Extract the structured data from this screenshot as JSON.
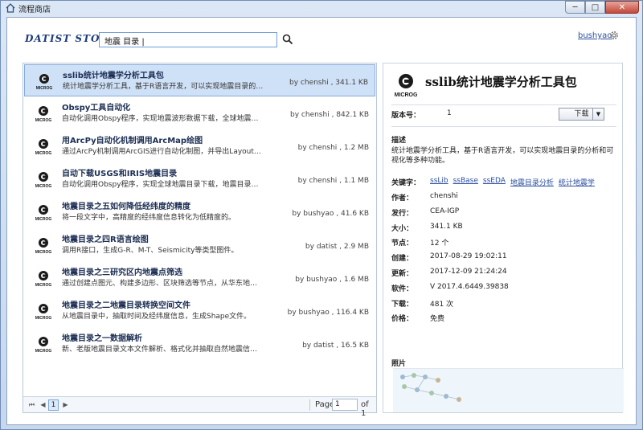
{
  "window": {
    "title": "流程商店",
    "min_label": "─",
    "max_label": "□",
    "close_label": "✕"
  },
  "header": {
    "logo_text": "DATIST STORE",
    "search_value": "地震 目录 |",
    "user": "bushyao"
  },
  "list": [
    {
      "title": "sslib统计地震学分析工具包",
      "desc": "统计地震学分析工具，基于R语言开发，可以实现地震目录的分析和可视化等多…",
      "meta": "by chenshi , 341.1 KB",
      "logo": "MICROG"
    },
    {
      "title": "Obspy工具自动化",
      "desc": "自动化调用Obspy程序，实现地震波形数据下载，全球地震目录下载等功能",
      "meta": "by chenshi , 842.1 KB",
      "logo": "MICROG"
    },
    {
      "title": "用ArcPy自动化机制调用ArcMap绘图",
      "desc": "通过ArcPy机制调用ArcGIS进行自动化制图，并导出Layout或Frame图形到本地…",
      "meta": "by chenshi , 1.2 MB",
      "logo": "MICROG"
    },
    {
      "title": "自动下载USGS和IRIS地震目录",
      "desc": "自动化调用Obspy程序，实现全球地震目录下载，地震目录格式转换（支持…",
      "meta": "by chenshi , 1.1 MB",
      "logo": "MICROG"
    },
    {
      "title": "地震目录之五如何降低经纬度的精度",
      "desc": "将一段文字中，高精度的经纬度信息转化为低精度的。",
      "meta": "by bushyao , 41.6 KB",
      "logo": "MICROG"
    },
    {
      "title": "地震目录之四R语言绘图",
      "desc": "调用R接口，生成G-R、M-T、Seismicity等类型图件。",
      "meta": "by datist , 2.9 MB",
      "logo": "MICROG"
    },
    {
      "title": "地震目录之三研究区内地震点筛选",
      "desc": "通过创建点图元、构建多边形、区块筛选等节点，从华东地震目录中抽取研究…",
      "meta": "by bushyao , 1.6 MB",
      "logo": "MICROG"
    },
    {
      "title": "地震目录之二地震目录转换空间文件",
      "desc": "从地震目录中，抽取时间及经纬度信息，生成Shape文件。",
      "meta": "by bushyao , 116.4 KB",
      "logo": "MICROG"
    },
    {
      "title": "地震目录之一数据解析",
      "desc": "新、老版地震目录文本文件解析、格式化并抽取自然地震信息。",
      "meta": "by datist , 16.5 KB",
      "logo": "MICROG"
    }
  ],
  "pager": {
    "first": "⏮",
    "prev": "◀",
    "current": "1",
    "next": "▶",
    "label": "Page",
    "value": "1",
    "of": "of 1"
  },
  "detail": {
    "logo_text": "MICROG",
    "title": "sslib统计地震学分析工具包",
    "version_label": "版本号：",
    "version": "1",
    "download": "下载",
    "desc_label": "描述",
    "desc": "统计地震学分析工具，基于R语言开发，可以实现地震目录的分析和可视化等多种功能。",
    "keywords_label": "关键字：",
    "keywords": [
      "ssLib",
      "ssBase",
      "ssEDA",
      "地震目录分析",
      "统计地震学"
    ],
    "fields": [
      {
        "label": "作者：",
        "value": "chenshi"
      },
      {
        "label": "发行：",
        "value": "CEA-IGP"
      },
      {
        "label": "大小：",
        "value": "341.1 KB"
      },
      {
        "label": "节点：",
        "value": "12 个"
      },
      {
        "label": "创建：",
        "value": "2017-08-29 19:02:11"
      },
      {
        "label": "更新：",
        "value": "2017-12-09 21:24:24"
      },
      {
        "label": "软件：",
        "value": "V 2017.4.6449.39838"
      },
      {
        "label": "下载：",
        "value": "481 次"
      },
      {
        "label": "价格：",
        "value": "免费"
      }
    ],
    "screenshot_label": "照片"
  },
  "colors": {
    "accent": "#2a4fa0",
    "selection": "#cfe1f7"
  }
}
